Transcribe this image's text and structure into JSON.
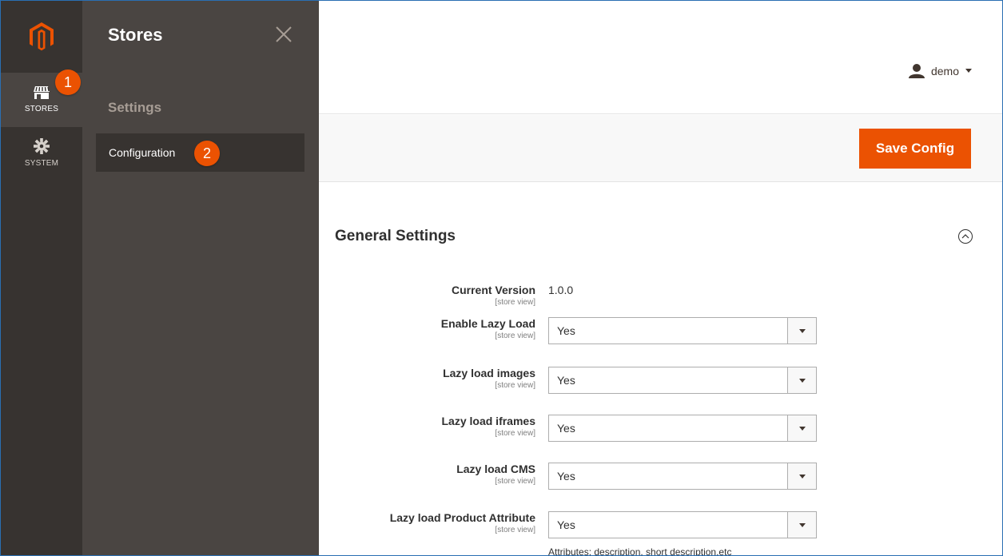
{
  "colors": {
    "accent": "#eb5202",
    "rail": "#373330",
    "flyout": "#4a4542"
  },
  "rail": {
    "items": [
      {
        "label": "STORES",
        "icon": "store-icon"
      },
      {
        "label": "SYSTEM",
        "icon": "gear-icon"
      }
    ]
  },
  "flyout": {
    "title": "Stores",
    "section": "Settings",
    "item": "Configuration"
  },
  "callouts": [
    "1",
    "2"
  ],
  "header": {
    "user": "demo"
  },
  "actions": {
    "save_label": "Save Config"
  },
  "section": {
    "title": "General Settings",
    "fields": [
      {
        "label": "Current Version",
        "scope": "[store view]",
        "value": "1.0.0"
      },
      {
        "label": "Enable Lazy Load",
        "scope": "[store view]",
        "value": "Yes"
      },
      {
        "label": "Lazy load images",
        "scope": "[store view]",
        "value": "Yes"
      },
      {
        "label": "Lazy load iframes",
        "scope": "[store view]",
        "value": "Yes"
      },
      {
        "label": "Lazy load CMS",
        "scope": "[store view]",
        "value": "Yes"
      },
      {
        "label": "Lazy load Product Attribute",
        "scope": "[store view]",
        "value": "Yes",
        "note": "Attributes: description, short description,etc"
      }
    ]
  }
}
